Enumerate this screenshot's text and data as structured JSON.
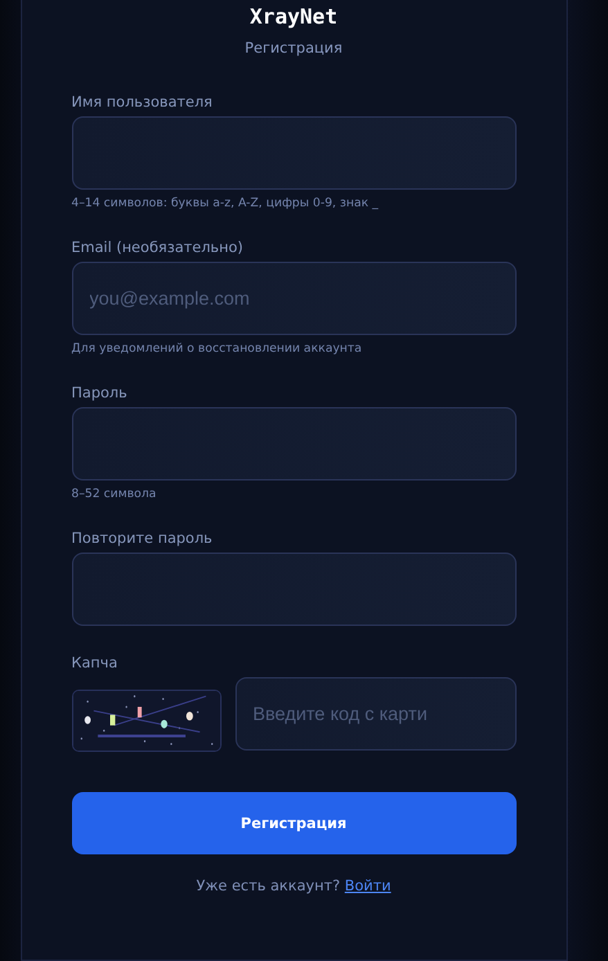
{
  "brand": {
    "title": "XrayNet",
    "subtitle": "Регистрация"
  },
  "fields": [
    {
      "kind": "text",
      "label": "Имя пользователя",
      "hint": "4–14 символов: буквы a-z, A-Z, цифры 0-9, знак _"
    },
    {
      "kind": "email",
      "label": "Email (необязательно)",
      "placeholder": "you@example.com",
      "hint": "Для уведомлений о восстановлении аккаунта"
    },
    {
      "kind": "password",
      "label": "Пароль",
      "hint": "8–52 символа"
    },
    {
      "kind": "password",
      "label": "Повторите пароль"
    },
    {
      "kind": "captcha",
      "label": "Капча",
      "placeholder": "Введите код с карти"
    }
  ],
  "submit": {
    "label": "Регистрация"
  },
  "footer": {
    "text": "Уже есть аккаунт?",
    "link": "Войти"
  }
}
